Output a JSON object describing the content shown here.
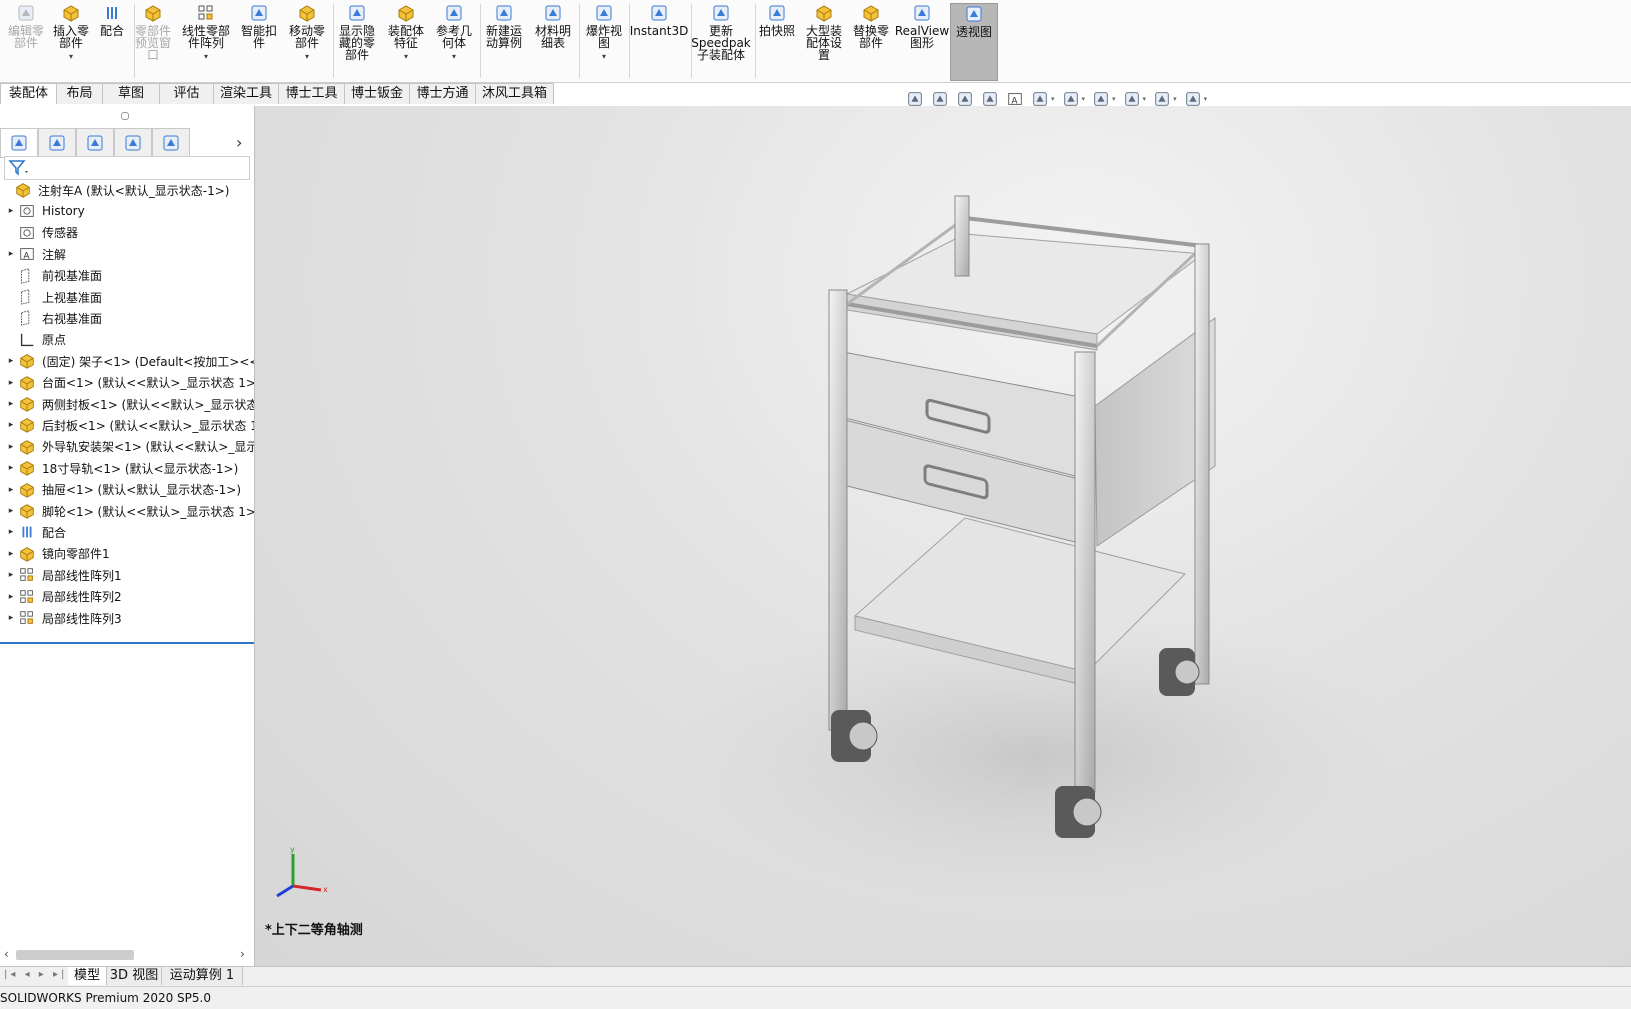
{
  "ribbon": [
    {
      "label": "编辑零\n部件",
      "icon": "edit-part-icon",
      "disabled": true
    },
    {
      "label": "插入零\n部件",
      "icon": "insert-component-icon",
      "dropdown": true
    },
    {
      "label": "配合",
      "icon": "mate-icon"
    },
    {
      "label": "零部件\n预览窗\n口",
      "icon": "component-preview-icon",
      "disabled": true
    },
    {
      "label": "线性零部\n件阵列",
      "icon": "linear-pattern-icon",
      "dropdown": true
    },
    {
      "label": "智能扣\n件",
      "icon": "smart-fastener-icon"
    },
    {
      "label": "移动零\n部件",
      "icon": "move-component-icon",
      "dropdown": true
    },
    {
      "label": "显示隐\n藏的零\n部件",
      "icon": "show-hidden-icon"
    },
    {
      "label": "装配体\n特征",
      "icon": "assembly-feature-icon",
      "dropdown": true
    },
    {
      "label": "参考几\n何体",
      "icon": "reference-geometry-icon",
      "dropdown": true
    },
    {
      "label": "新建运\n动算例",
      "icon": "new-motion-study-icon"
    },
    {
      "label": "材料明\n细表",
      "icon": "bom-icon"
    },
    {
      "label": "爆炸视\n图",
      "icon": "exploded-view-icon",
      "dropdown": true
    },
    {
      "label": "Instant3D",
      "icon": "instant3d-icon"
    },
    {
      "label": "更新\nSpeedpak\n子装配体",
      "icon": "speedpak-icon"
    },
    {
      "label": "拍快照",
      "icon": "snapshot-icon"
    },
    {
      "label": "大型装\n配体设\n置",
      "icon": "large-assembly-icon"
    },
    {
      "label": "替换零\n部件",
      "icon": "replace-component-icon"
    },
    {
      "label": "RealView\n图形",
      "icon": "realview-icon"
    },
    {
      "label": "透视图",
      "icon": "perspective-icon",
      "active": true
    }
  ],
  "command_tabs": [
    "装配体",
    "布局",
    "草图",
    "评估",
    "渲染工具",
    "博士工具",
    "博士钣金",
    "博士方通",
    "沐风工具箱"
  ],
  "view_toolbar_icons": [
    "zoom-to-fit-icon",
    "zoom-area-icon",
    "previous-view-icon",
    "section-view-icon",
    "dynamic-annotation-icon",
    "view-orientation-icon",
    "display-style-icon",
    "hide-show-icon",
    "edit-appearance-icon",
    "apply-scene-icon",
    "view-settings-icon"
  ],
  "panel_tabs": [
    "feature-manager-icon",
    "property-manager-icon",
    "configuration-manager-icon",
    "dimxpert-icon",
    "display-manager-icon"
  ],
  "tree": [
    {
      "label": "注射车A  (默认<默认_显示状态-1>)",
      "icon": "assembly-icon",
      "expand": false,
      "indent": 0
    },
    {
      "label": "History",
      "icon": "history-icon",
      "expand": true,
      "indent": 1
    },
    {
      "label": "传感器",
      "icon": "sensor-icon",
      "expand": false,
      "indent": 1
    },
    {
      "label": "注解",
      "icon": "annotation-icon",
      "expand": true,
      "indent": 1
    },
    {
      "label": "前视基准面",
      "icon": "plane-icon",
      "expand": false,
      "indent": 1
    },
    {
      "label": "上视基准面",
      "icon": "plane-icon",
      "expand": false,
      "indent": 1
    },
    {
      "label": "右视基准面",
      "icon": "plane-icon",
      "expand": false,
      "indent": 1
    },
    {
      "label": "原点",
      "icon": "origin-icon",
      "expand": false,
      "indent": 1
    },
    {
      "label": "(固定) 架子<1> (Default<按加工><<",
      "icon": "subassembly-icon",
      "expand": true,
      "indent": 1
    },
    {
      "label": "台面<1> (默认<<默认>_显示状态 1>)",
      "icon": "subassembly-icon",
      "expand": true,
      "indent": 1
    },
    {
      "label": "两侧封板<1> (默认<<默认>_显示状态",
      "icon": "subassembly-icon",
      "expand": true,
      "indent": 1
    },
    {
      "label": "后封板<1> (默认<<默认>_显示状态 1",
      "icon": "subassembly-icon",
      "expand": true,
      "indent": 1
    },
    {
      "label": "外导轨安装架<1> (默认<<默认>_显示",
      "icon": "subassembly-icon",
      "expand": true,
      "indent": 1
    },
    {
      "label": "18寸导轨<1> (默认<显示状态-1>)",
      "icon": "subassembly-blue-icon",
      "expand": true,
      "indent": 1
    },
    {
      "label": "抽屉<1> (默认<默认_显示状态-1>)",
      "icon": "subassembly-blue-icon",
      "expand": true,
      "indent": 1
    },
    {
      "label": "脚轮<1> (默认<<默认>_显示状态 1>)",
      "icon": "subassembly-icon",
      "expand": true,
      "indent": 1
    },
    {
      "label": "配合",
      "icon": "mates-folder-icon",
      "expand": true,
      "indent": 1
    },
    {
      "label": "镜向零部件1",
      "icon": "mirror-component-icon",
      "expand": true,
      "indent": 1
    },
    {
      "label": "局部线性阵列1",
      "icon": "local-pattern-icon",
      "expand": true,
      "indent": 1
    },
    {
      "label": "局部线性阵列2",
      "icon": "local-pattern-icon",
      "expand": true,
      "indent": 1
    },
    {
      "label": "局部线性阵列3",
      "icon": "local-pattern-icon",
      "expand": true,
      "indent": 1
    }
  ],
  "viewport": {
    "view_name": "*上下二等角轴测",
    "triad": {
      "x": "x",
      "y": "y"
    }
  },
  "bottom_tabs": [
    "模型",
    "3D 视图",
    "运动算例 1"
  ],
  "status": "SOLIDWORKS Premium 2020 SP5.0",
  "colors": {
    "accent": "#2a76c6",
    "icon_yellow": "#e8b020",
    "icon_blue": "#3a7bd5"
  }
}
